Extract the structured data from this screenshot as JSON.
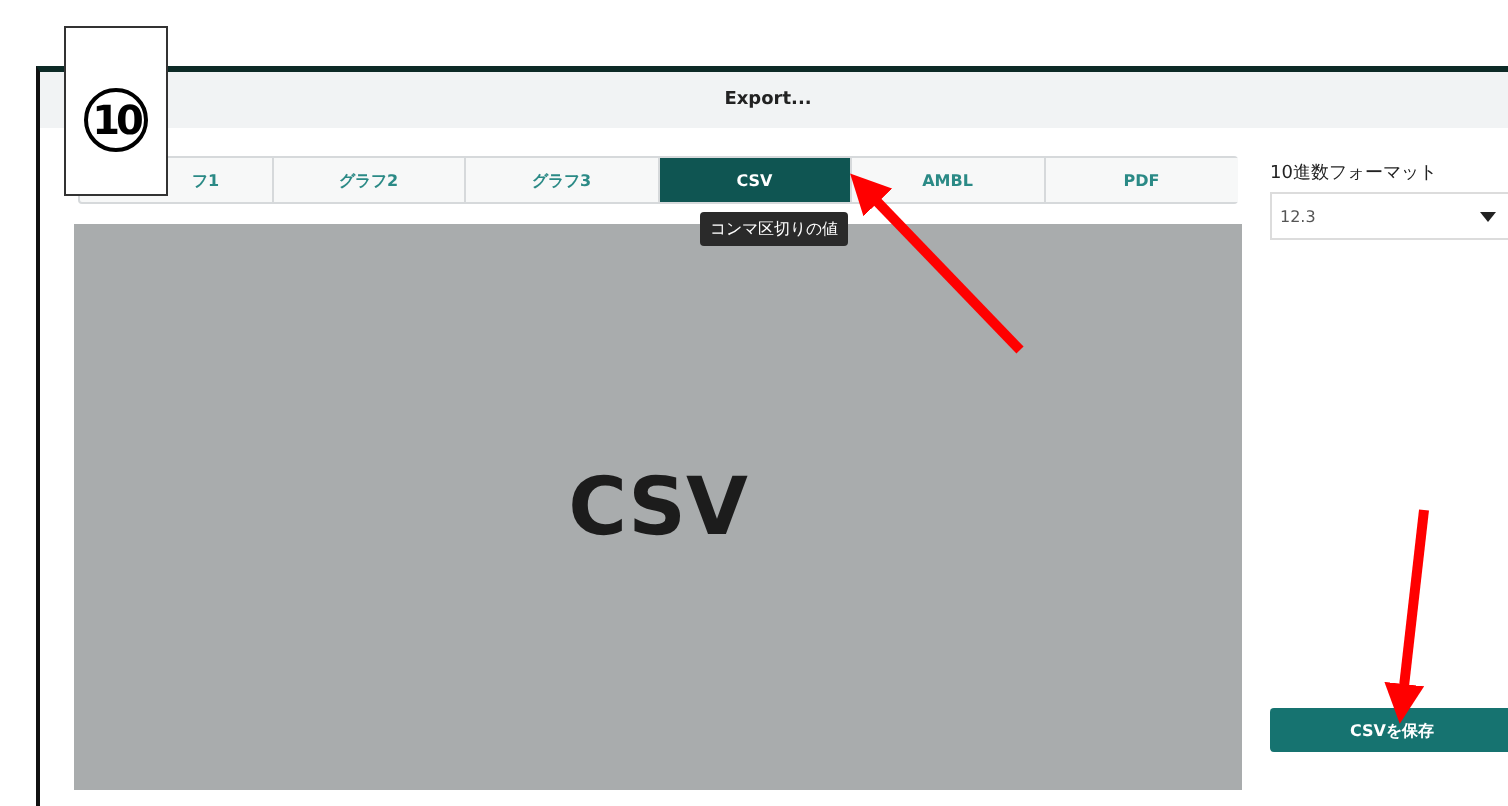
{
  "step_badge": "10",
  "window": {
    "title": "Export..."
  },
  "tabs": [
    {
      "label": "フ1",
      "selected": false
    },
    {
      "label": "グラフ2",
      "selected": false
    },
    {
      "label": "グラフ3",
      "selected": false
    },
    {
      "label": "CSV",
      "selected": true
    },
    {
      "label": "AMBL",
      "selected": false
    },
    {
      "label": "PDF",
      "selected": false
    }
  ],
  "tooltip": "コンマ区切りの値",
  "preview": {
    "label": "CSV"
  },
  "decimal_format": {
    "label": "10進数フォーマット",
    "value": "12.3"
  },
  "save_button": "CSVを保存"
}
